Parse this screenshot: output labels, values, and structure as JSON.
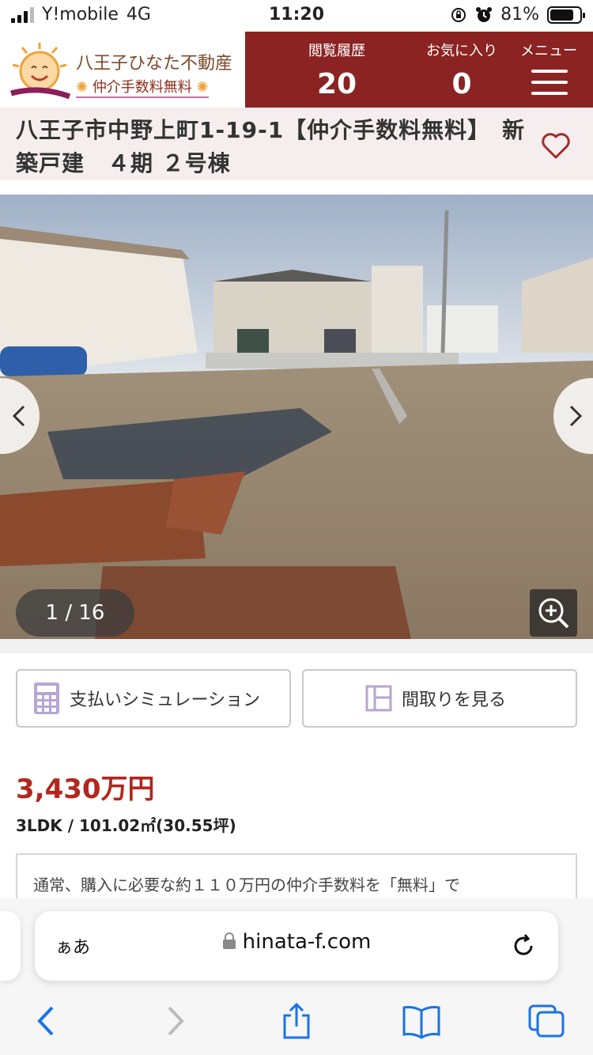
{
  "status_bar": {
    "carrier": "Y!mobile",
    "network": "4G",
    "time": "11:20",
    "battery_percent": "81%",
    "battery_level": 0.81
  },
  "header": {
    "logo_name": "八王子ひなた不動産",
    "logo_tagline": "仲介手数料無料",
    "nav": [
      {
        "label": "閲覧履歴",
        "count": "20"
      },
      {
        "label": "お気に入り",
        "count": "0"
      },
      {
        "label": "メニュー"
      }
    ],
    "colors": {
      "nav_bg": "#8b2323",
      "title_bg": "#f6eeee",
      "price": "#b3261e"
    }
  },
  "listing": {
    "title": "八王子市中野上町1-19-1【仲介手数料無料】　新築戸建　４期 ２号棟",
    "photo_counter": "1 / 16",
    "price": "3,430万円",
    "spec": "3LDK / 101.02㎡(30.55坪)",
    "description": "通常、購入に必要な約１１０万円の仲介手数料を「無料」で"
  },
  "buttons": {
    "simulation": "支払いシミュレーション",
    "floorplan": "間取りを見る"
  },
  "browser": {
    "text_size": "ぁあ",
    "url": "hinata-f.com"
  },
  "icons": [
    "heart-icon",
    "chevron-left-icon",
    "chevron-right-icon",
    "zoom-in-icon",
    "calculator-icon",
    "floorplan-icon",
    "lock-icon",
    "reload-icon",
    "back-icon",
    "forward-icon",
    "share-icon",
    "bookmarks-icon",
    "tabs-icon"
  ]
}
